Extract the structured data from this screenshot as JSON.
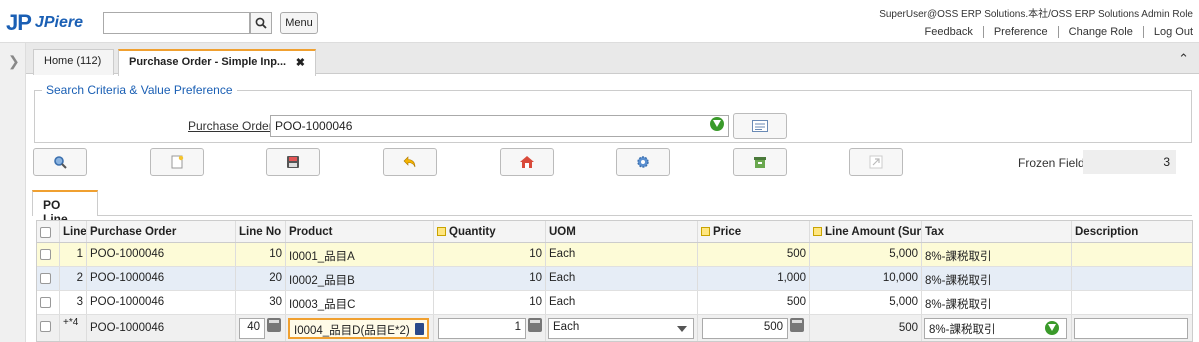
{
  "header": {
    "logo_mark": "JP",
    "logo_text": "JPiere",
    "search_value": "",
    "menu_label": "Menu",
    "user_info": "SuperUser@OSS ERP Solutions.本社/OSS ERP Solutions Admin Role",
    "links": [
      "Feedback",
      "Preference",
      "Change Role",
      "Log Out"
    ]
  },
  "tabs": {
    "home_label": "Home (112)",
    "active_label": "Purchase Order - Simple Inp..."
  },
  "criteria": {
    "title": "Search Criteria & Value Preference",
    "po_label": "Purchase Order",
    "po_value": "POO-1000046"
  },
  "toolbar": {
    "frozen_label": "Frozen Field",
    "frozen_value": "3"
  },
  "subtab": {
    "label": "PO Line"
  },
  "grid": {
    "columns": [
      "Line",
      "Purchase Order",
      "Line No",
      "Product",
      "Quantity",
      "UOM",
      "Price",
      "Line Amount (Sun",
      "Tax",
      "Description"
    ],
    "rows": [
      {
        "line": "1",
        "po": "POO-1000046",
        "line_no": "10",
        "product": "I0001_品目A",
        "qty": "10",
        "uom": "Each",
        "price": "500",
        "amount": "5,000",
        "tax": "8%-課税取引",
        "desc": ""
      },
      {
        "line": "2",
        "po": "POO-1000046",
        "line_no": "20",
        "product": "I0002_品目B",
        "qty": "10",
        "uom": "Each",
        "price": "1,000",
        "amount": "10,000",
        "tax": "8%-課税取引",
        "desc": ""
      },
      {
        "line": "3",
        "po": "POO-1000046",
        "line_no": "30",
        "product": "I0003_品目C",
        "qty": "10",
        "uom": "Each",
        "price": "500",
        "amount": "5,000",
        "tax": "8%-課税取引",
        "desc": ""
      }
    ],
    "edit_row": {
      "line": "+*4",
      "po": "POO-1000046",
      "line_no": "40",
      "product": "I0004_品目D(品目E*2)",
      "qty": "1",
      "uom": "Each",
      "price": "500",
      "amount": "500",
      "tax": "8%-課税取引",
      "desc": ""
    }
  },
  "colors": {
    "accent": "#1a5fb4",
    "tab_highlight": "#f0a030",
    "selected_row": "#fdfbd7",
    "alt_row": "#e6edf6"
  }
}
